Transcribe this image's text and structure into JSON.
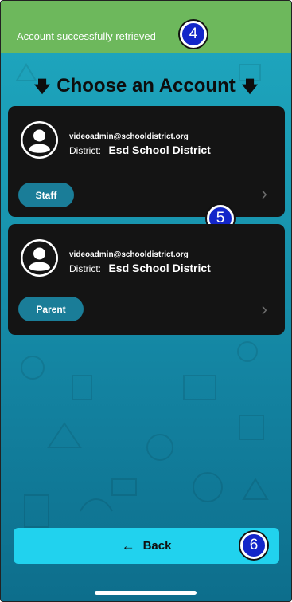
{
  "toast": {
    "message": "Account successfully retrieved"
  },
  "annotations": {
    "badge_4": "4",
    "badge_5": "5",
    "badge_6": "6"
  },
  "heading": {
    "arrow_left": "🡇",
    "title": "Choose an Account",
    "arrow_right": "🡇"
  },
  "accounts": [
    {
      "email": "videoadmin@schooldistrict.org",
      "district_label": "District:",
      "district_name": "Esd School District",
      "role": "Staff"
    },
    {
      "email": "videoadmin@schooldistrict.org",
      "district_label": "District:",
      "district_name": "Esd School District",
      "role": "Parent"
    }
  ],
  "footer": {
    "back_label": "Back",
    "back_icon": "←"
  },
  "icons": {
    "chevron": "›",
    "avatar": "user-icon"
  },
  "colors": {
    "toast": "#6db85c",
    "card": "#141414",
    "role_button": "#1a7d98",
    "back_button": "#21d2ee",
    "badge": "#1326c9"
  }
}
